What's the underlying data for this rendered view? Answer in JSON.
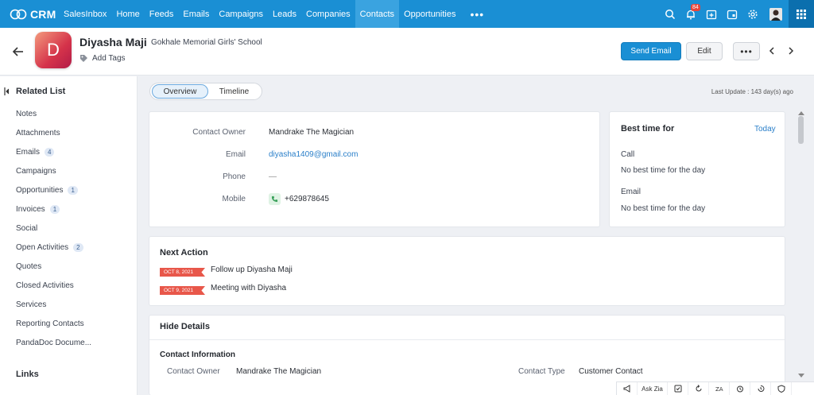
{
  "nav": {
    "brand": "CRM",
    "modules": [
      "SalesInbox",
      "Home",
      "Feeds",
      "Emails",
      "Campaigns",
      "Leads",
      "Companies",
      "Contacts",
      "Opportunities"
    ],
    "active_module": "Contacts",
    "notification_count": "84"
  },
  "record": {
    "avatar_letter": "D",
    "name": "Diyasha Maji",
    "separator": "-",
    "school": "Gokhale Memorial Girls' School",
    "add_tags": "Add Tags",
    "send_email": "Send Email",
    "edit": "Edit"
  },
  "sidebar": {
    "title": "Related List",
    "items": [
      {
        "label": "Notes",
        "count": ""
      },
      {
        "label": "Attachments",
        "count": ""
      },
      {
        "label": "Emails",
        "count": "4"
      },
      {
        "label": "Campaigns",
        "count": ""
      },
      {
        "label": "Opportunities",
        "count": "1"
      },
      {
        "label": "Invoices",
        "count": "1"
      },
      {
        "label": "Social",
        "count": ""
      },
      {
        "label": "Open Activities",
        "count": "2"
      },
      {
        "label": "Quotes",
        "count": ""
      },
      {
        "label": "Closed Activities",
        "count": ""
      },
      {
        "label": "Services",
        "count": ""
      },
      {
        "label": "Reporting Contacts",
        "count": ""
      },
      {
        "label": "PandaDoc Docume...",
        "count": ""
      }
    ],
    "links": "Links"
  },
  "tabs": {
    "overview": "Overview",
    "timeline": "Timeline",
    "last_update": "Last Update : 143 day(s) ago"
  },
  "summary": {
    "owner_label": "Contact Owner",
    "owner": "Mandrake The Magician",
    "email_label": "Email",
    "email": "diyasha1409@gmail.com",
    "phone_label": "Phone",
    "phone": "—",
    "mobile_label": "Mobile",
    "mobile": "+629878645"
  },
  "best_time": {
    "title": "Best time for",
    "today": "Today",
    "call_label": "Call",
    "call_value": "No best time for the day",
    "email_label": "Email",
    "email_value": "No best time for the day"
  },
  "next_action": {
    "title": "Next Action",
    "items": [
      {
        "date": "OCT 8, 2021",
        "text": "Follow up Diyasha Maji"
      },
      {
        "date": "OCT 9, 2021",
        "text": "Meeting with Diyasha"
      }
    ]
  },
  "details": {
    "title": "Hide Details",
    "section": "Contact Information",
    "owner_label": "Contact Owner",
    "owner": "Mandrake The Magician",
    "type_label": "Contact Type",
    "type": "Customer Contact"
  },
  "bottombar": {
    "ask_zia": "Ask Zia"
  }
}
